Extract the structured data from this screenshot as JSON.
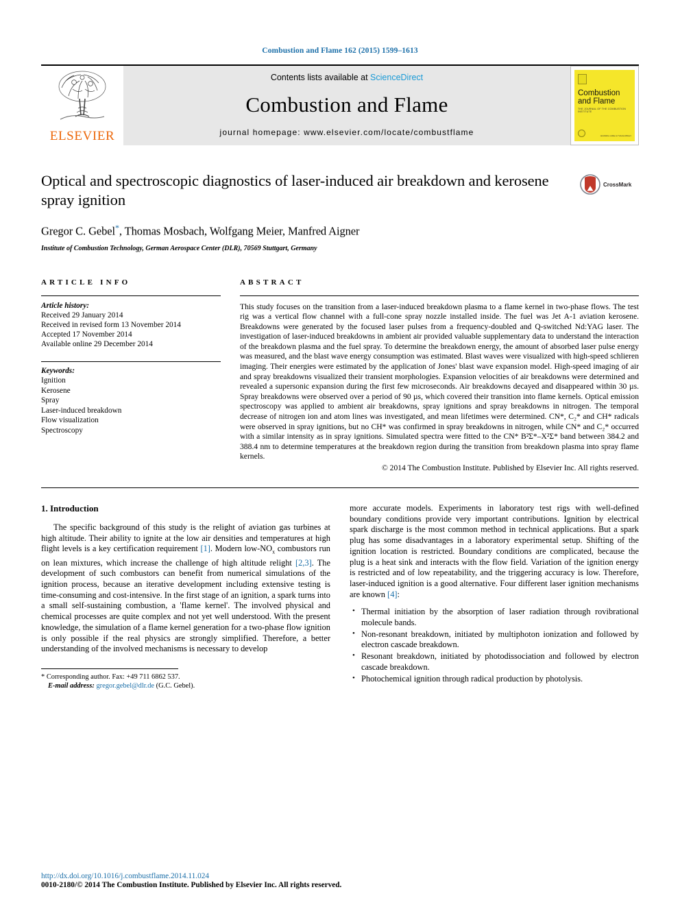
{
  "running_head": "Combustion and Flame 162 (2015) 1599–1613",
  "masthead": {
    "contents_prefix": "Contents lists available at ",
    "sciencedirect": "ScienceDirect",
    "journal_title": "Combustion and Flame",
    "homepage": "journal homepage: www.elsevier.com/locate/combustflame",
    "publisher_wordmark": "ELSEVIER",
    "cover": {
      "title_line1": "Combustion",
      "title_line2": "and Flame",
      "subtitle": "THE JOURNAL OF THE COMBUSTION INSTITUTE",
      "footer_note": "Available online at\nScienceDirect"
    }
  },
  "article": {
    "title": "Optical and spectroscopic diagnostics of laser-induced air breakdown and kerosene spray ignition",
    "authors_part1": "Gregor C. Gebel",
    "corresponding_marker": "*",
    "authors_part2": ", Thomas Mosbach, Wolfgang Meier, Manfred Aigner",
    "affiliation": "Institute of Combustion Technology, German Aerospace Center (DLR), 70569 Stuttgart, Germany",
    "crossmark_label": "CrossMark"
  },
  "article_info": {
    "heading": "ARTICLE INFO",
    "history_label": "Article history:",
    "history": [
      "Received 29 January 2014",
      "Received in revised form 13 November 2014",
      "Accepted 17 November 2014",
      "Available online 29 December 2014"
    ],
    "keywords_label": "Keywords:",
    "keywords": [
      "Ignition",
      "Kerosene",
      "Spray",
      "Laser-induced breakdown",
      "Flow visualization",
      "Spectroscopy"
    ]
  },
  "abstract": {
    "heading": "ABSTRACT",
    "text": "This study focuses on the transition from a laser-induced breakdown plasma to a flame kernel in two-phase flows. The test rig was a vertical flow channel with a full-cone spray nozzle installed inside. The fuel was Jet A-1 aviation kerosene. Breakdowns were generated by the focused laser pulses from a frequency-doubled and Q-switched Nd:YAG laser. The investigation of laser-induced breakdowns in ambient air provided valuable supplementary data to understand the interaction of the breakdown plasma and the fuel spray. To determine the breakdown energy, the amount of absorbed laser pulse energy was measured, and the blast wave energy consumption was estimated. Blast waves were visualized with high-speed schlieren imaging. Their energies were estimated by the application of Jones' blast wave expansion model. High-speed imaging of air and spray breakdowns visualized their transient morphologies. Expansion velocities of air breakdowns were determined and revealed a supersonic expansion during the first few microseconds. Air breakdowns decayed and disappeared within 30 µs. Spray breakdowns were observed over a period of 90 µs, which covered their transition into flame kernels. Optical emission spectroscopy was applied to ambient air breakdowns, spray ignitions and spray breakdowns in nitrogen. The temporal decrease of nitrogen ion and atom lines was investigated, and mean lifetimes were determined. CN*, C₂* and CH* radicals were observed in spray ignitions, but no CH* was confirmed in spray breakdowns in nitrogen, while CN* and C₂* occurred with a similar intensity as in spray ignitions. Simulated spectra were fitted to the CN* B²Σ*–X²Σ* band between 384.2 and 388.4 nm to determine temperatures at the breakdown region during the transition from breakdown plasma into spray flame kernels.",
    "copyright": "© 2014 The Combustion Institute. Published by Elsevier Inc. All rights reserved."
  },
  "introduction": {
    "heading": "1. Introduction",
    "left_para_1": "The specific background of this study is the relight of aviation gas turbines at high altitude. Their ability to ignite at the low air densities and temperatures at high flight levels is a key certification requirement ",
    "ref_1": "[1]",
    "left_para_2": ". Modern low-NO",
    "nox_sub": "x",
    "left_para_3": " combustors run on lean mixtures, which increase the challenge of high altitude relight ",
    "ref_23": "[2,3]",
    "left_para_4": ". The development of such combustors can benefit from numerical simulations of the ignition process, because an iterative development including extensive testing is time-consuming and cost-intensive. In the first stage of an ignition, a spark turns into a small self-sustaining combustion, a 'flame kernel'. The involved physical and chemical processes are quite complex and not yet well understood. With the present knowledge, the simulation of a flame kernel generation for a two-phase flow ignition is only possible if the real physics are strongly simplified. Therefore, a better understanding of the involved mechanisms is necessary to develop",
    "right_para_1": "more accurate models. Experiments in laboratory test rigs with well-defined boundary conditions provide very important contributions. Ignition by electrical spark discharge is the most common method in technical applications. But a spark plug has some disadvantages in a laboratory experimental setup. Shifting of the ignition location is restricted. Boundary conditions are complicated, because the plug is a heat sink and interacts with the flow field. Variation of the ignition energy is restricted and of low repeatability, and the triggering accuracy is low. Therefore, laser-induced ignition is a good alternative. Four different laser ignition mechanisms are known ",
    "ref_4": "[4]",
    "right_para_2": ":",
    "mechanisms": [
      "Thermal initiation by the absorption of laser radiation through rovibrational molecule bands.",
      "Non-resonant breakdown, initiated by multiphoton ionization and followed by electron cascade breakdown.",
      "Resonant breakdown, initiated by photodissociation and followed by electron cascade breakdown.",
      "Photochemical ignition through radical production by photolysis."
    ]
  },
  "footnote": {
    "marker": "*",
    "corresponding": "Corresponding author. Fax: +49 711 6862 537.",
    "email_label": "E-mail address:",
    "email": "gregor.gebel@dlr.de",
    "email_owner": "(G.C. Gebel)."
  },
  "page_footer": {
    "doi": "http://dx.doi.org/10.1016/j.combustflame.2014.11.024",
    "copyright": "0010-2180/© 2014 The Combustion Institute. Published by Elsevier Inc. All rights reserved."
  },
  "colors": {
    "link_blue": "#1a6ea8",
    "sciencedirect_blue": "#1a9ad6",
    "elsevier_orange": "#ec6608",
    "cover_yellow": "#f5e62a",
    "masthead_gray": "#e7e7e7"
  }
}
